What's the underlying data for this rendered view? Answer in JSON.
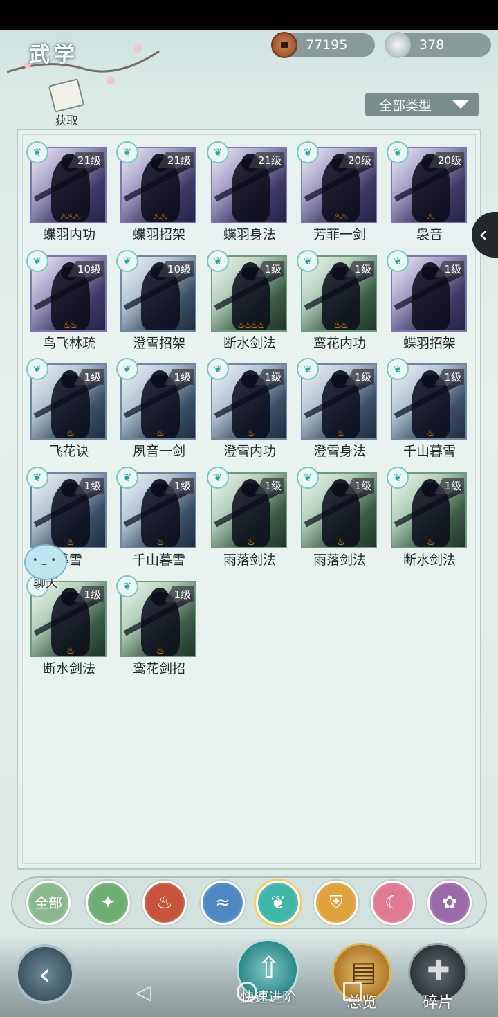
{
  "header": {
    "title": "武学",
    "coins": "77195",
    "silver": "378",
    "get_label": "获取",
    "type_filter": "全部类型"
  },
  "skills": [
    {
      "name": "蝶羽内功",
      "level": "21级",
      "flames": 3,
      "theme": "purple"
    },
    {
      "name": "蝶羽招架",
      "level": "21级",
      "flames": 2,
      "theme": "purple"
    },
    {
      "name": "蝶羽身法",
      "level": "21级",
      "flames": 0,
      "theme": "purple"
    },
    {
      "name": "芳菲一剑",
      "level": "20级",
      "flames": 2,
      "theme": "purple"
    },
    {
      "name": "袅音",
      "level": "20级",
      "flames": 1,
      "theme": "purple"
    },
    {
      "name": "鸟飞林疏",
      "level": "10级",
      "flames": 2,
      "theme": "purple"
    },
    {
      "name": "澄雪招架",
      "level": "10级",
      "flames": 0,
      "theme": "blue"
    },
    {
      "name": "断水剑法",
      "level": "1级",
      "flames": 4,
      "theme": "green"
    },
    {
      "name": "鸾花内功",
      "level": "1级",
      "flames": 2,
      "theme": "green"
    },
    {
      "name": "蝶羽招架",
      "level": "1级",
      "flames": 0,
      "theme": "purple"
    },
    {
      "name": "飞花诀",
      "level": "1级",
      "flames": 1,
      "theme": "blue"
    },
    {
      "name": "夙音一剑",
      "level": "1级",
      "flames": 1,
      "theme": "blue"
    },
    {
      "name": "澄雪内功",
      "level": "1级",
      "flames": 1,
      "theme": "blue"
    },
    {
      "name": "澄雪身法",
      "level": "1级",
      "flames": 1,
      "theme": "blue"
    },
    {
      "name": "千山暮雪",
      "level": "1级",
      "flames": 1,
      "theme": "blue"
    },
    {
      "name": "暮雪",
      "level": "1级",
      "flames": 1,
      "theme": "blue"
    },
    {
      "name": "千山暮雪",
      "level": "1级",
      "flames": 1,
      "theme": "blue"
    },
    {
      "name": "雨落剑法",
      "level": "1级",
      "flames": 1,
      "theme": "green"
    },
    {
      "name": "雨落剑法",
      "level": "1级",
      "flames": 1,
      "theme": "green"
    },
    {
      "name": "断水剑法",
      "level": "1级",
      "flames": 1,
      "theme": "green"
    },
    {
      "name": "断水剑法",
      "level": "1级",
      "flames": 1,
      "theme": "green"
    },
    {
      "name": "鸾花剑招",
      "level": "1级",
      "flames": 1,
      "theme": "green"
    }
  ],
  "chat_label": "聊天",
  "school_filters": [
    {
      "label": "全部",
      "color": "#8bb98e",
      "icon": "all-icon"
    },
    {
      "color": "#6fae72",
      "icon": "feather-blade-icon"
    },
    {
      "color": "#c9523a",
      "icon": "flame-icon"
    },
    {
      "color": "#4d88c2",
      "icon": "wave-icon"
    },
    {
      "color": "#3fb6a8",
      "icon": "butterfly-icon"
    },
    {
      "color": "#e0a23a",
      "icon": "shield-icon"
    },
    {
      "color": "#e07a92",
      "icon": "moon-icon"
    },
    {
      "color": "#9a6aa8",
      "icon": "rose-icon"
    }
  ],
  "bottom": {
    "quick_advance": "快速进阶",
    "overview": "总览",
    "fragments": "碎片"
  }
}
